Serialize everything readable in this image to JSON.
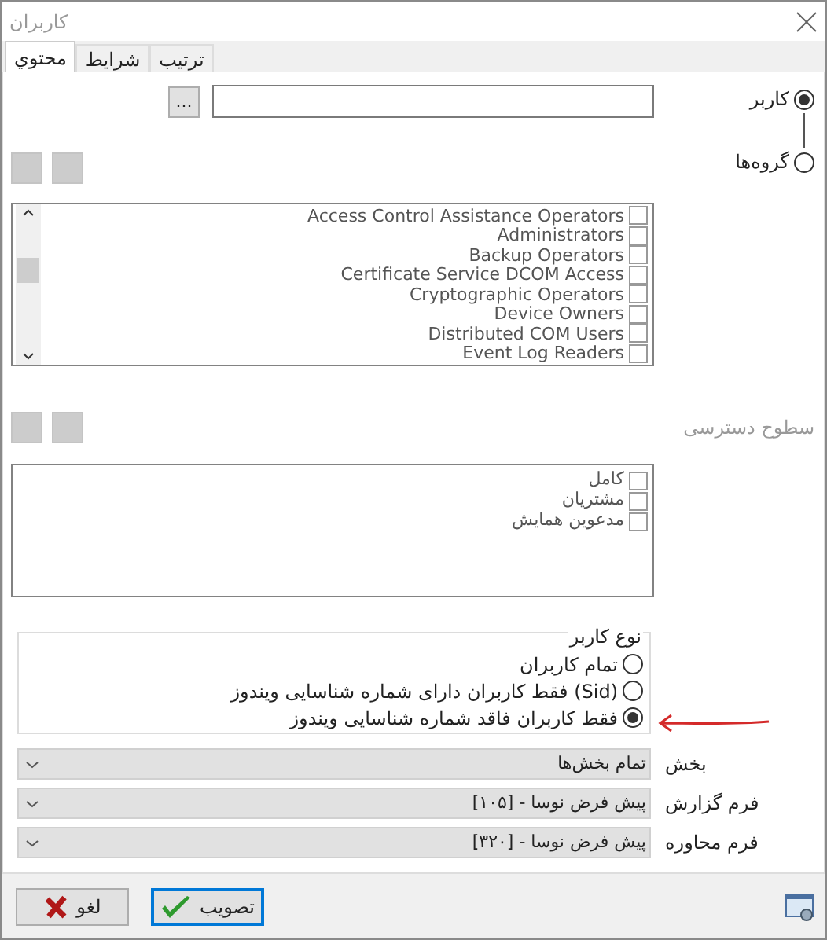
{
  "window": {
    "title": "کاربران"
  },
  "tabs": [
    {
      "label": "ترتیب",
      "selected": false
    },
    {
      "label": "شرایط",
      "selected": false
    },
    {
      "label": "محتوي",
      "selected": true
    }
  ],
  "user_source": {
    "options": [
      {
        "label": "کاربر",
        "selected": true
      },
      {
        "label": "گروه‌ها",
        "selected": false
      }
    ],
    "browse_button": "..."
  },
  "groups": [
    {
      "label": "Access Control Assistance Operators",
      "checked": false
    },
    {
      "label": "Administrators",
      "checked": false
    },
    {
      "label": "Backup Operators",
      "checked": false
    },
    {
      "label": "Certificate Service DCOM Access",
      "checked": false
    },
    {
      "label": "Cryptographic Operators",
      "checked": false
    },
    {
      "label": "Device Owners",
      "checked": false
    },
    {
      "label": "Distributed COM Users",
      "checked": false
    },
    {
      "label": "Event Log Readers",
      "checked": false
    }
  ],
  "access_levels": {
    "label": "سطوح دسترسی",
    "items": [
      {
        "label": "کامل",
        "checked": false
      },
      {
        "label": "مشتریان",
        "checked": false
      },
      {
        "label": "مدعوین همایش",
        "checked": false
      }
    ]
  },
  "user_type": {
    "title": "نوع کاربر",
    "options": [
      {
        "label": "تمام کاربران",
        "selected": false
      },
      {
        "label": "فقط کاربران دارای شماره شناسایی ویندوز (Sid)",
        "selected": false
      },
      {
        "label": "فقط کاربران فاقد شماره شناسایی ویندوز",
        "selected": true
      }
    ]
  },
  "fields": [
    {
      "label": "بخش",
      "value": "تمام بخش‌ها"
    },
    {
      "label": "فرم گزارش",
      "value": "پیش فرض نوسا - [۱۰۵]"
    },
    {
      "label": "فرم محاوره",
      "value": "پیش فرض نوسا - [۳۲۰]"
    }
  ],
  "buttons": [
    {
      "label": "تصویب",
      "kind": "ok"
    },
    {
      "label": "لغو",
      "kind": "cancel"
    }
  ]
}
